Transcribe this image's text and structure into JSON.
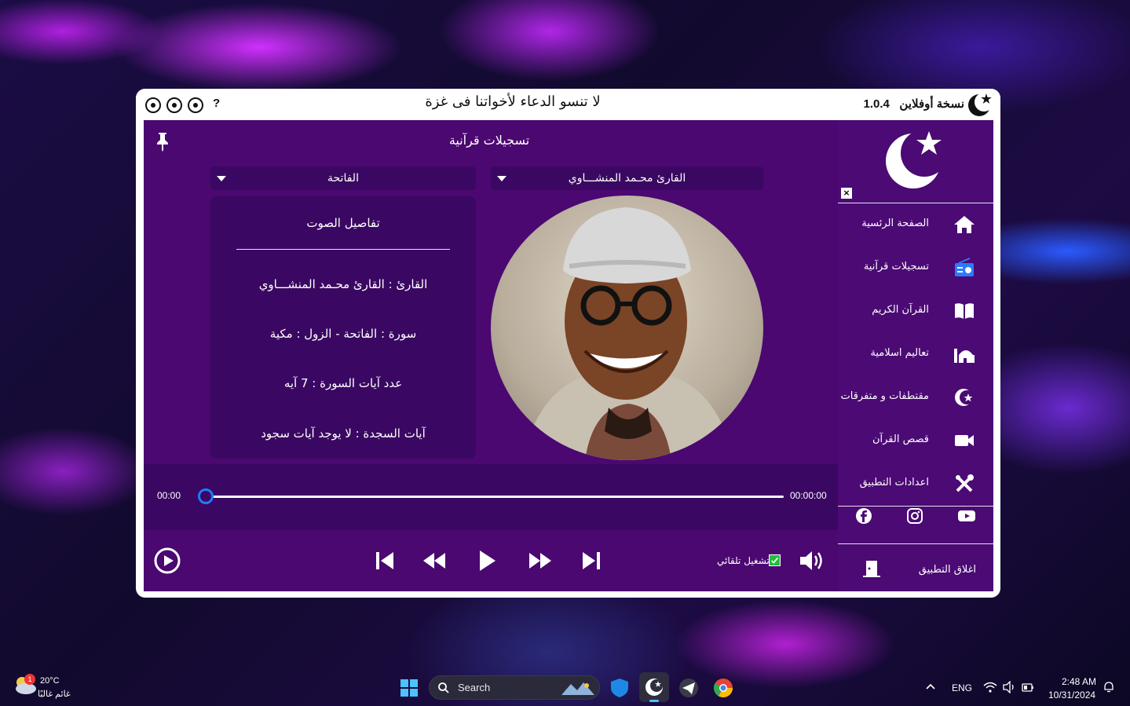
{
  "window": {
    "motto": "لا تنسو الدعاء لأخواتنا فى غزة",
    "version_label": "نسخة أوفلاين",
    "version_number": "1.0.4",
    "help": "?"
  },
  "player": {
    "page_title": "تسجيلات قرآنية",
    "reciter_dropdown": "القارئ محـمد المنشـــاوي",
    "surah_dropdown": "الفاتحة",
    "details_title": "تفاصيل الصوت",
    "reciter_line": "القارئ : القارئ محـمد المنشـــاوي",
    "surah_line": "سورة :  الفاتحة  -  الزول  :  مكية",
    "verses_line": "عدد آيات السورة :  7  آيه",
    "sajda_line": "آيات السجدة :  لا يوجد آيات سجود",
    "time_current": "00:00",
    "time_total": "00:00:00",
    "progress_fraction": 0.0,
    "autoplay_label": "تشغيل تلقائي",
    "autoplay_checked": true
  },
  "sidebar": {
    "close": "×",
    "items": [
      {
        "label": "الصفحة الرئسية",
        "icon": "home-icon"
      },
      {
        "label": "تسجيلات قرآنية",
        "icon": "radio-icon"
      },
      {
        "label": "القرآن الكريم",
        "icon": "book-icon"
      },
      {
        "label": "تعاليم اسلامية",
        "icon": "mosque-icon"
      },
      {
        "label": "مقتطفات و متفرقات",
        "icon": "crescent-star-icon"
      },
      {
        "label": "قصص القرآن",
        "icon": "video-icon"
      },
      {
        "label": "اعدادات التطبيق",
        "icon": "settings-tools-icon"
      }
    ],
    "exit_label": "اغلاق التطبيق"
  },
  "taskbar": {
    "search_placeholder": "Search",
    "weather_temp": "20°C",
    "weather_desc": "غائم غالبًا",
    "weather_badge": "1",
    "language": "ENG",
    "time": "2:48 AM",
    "date": "10/31/2024"
  },
  "colors": {
    "accent": "#4b0a74",
    "dark_panel": "#3a0862",
    "progress_knob": "#1e7cff",
    "checkbox": "#1fbf3a"
  }
}
